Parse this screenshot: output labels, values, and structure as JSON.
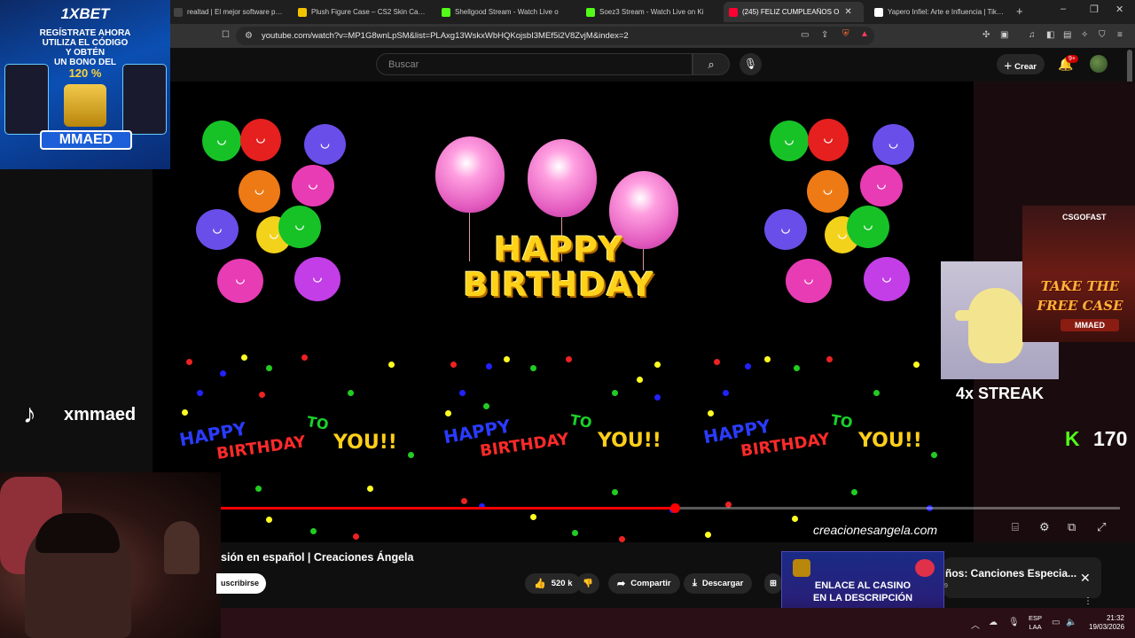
{
  "browser": {
    "tabs": [
      {
        "title": "realtad | El mejor software para pote",
        "favicon_color": "#444444"
      },
      {
        "title": "Plush Figure Case – CS2 Skin Case O",
        "favicon_color": "#f2c400"
      },
      {
        "title": "Shellgood Stream - Watch Live o",
        "favicon_color": "#53fc18"
      },
      {
        "title": "Soez3 Stream - Watch Live on Ki",
        "favicon_color": "#53fc18"
      },
      {
        "title": "(245) FELIZ CUMPLEAÑOS O",
        "favicon_color": "#ff0033",
        "active": true
      },
      {
        "title": "Yapero Infiel: Arte e Influencia | TikTo",
        "favicon_color": "#ffffff"
      }
    ],
    "new_tab": "+",
    "window_controls": [
      "–",
      "❐",
      "✕"
    ],
    "url": "youtube.com/watch?v=MP1G8wnLpSM&list=PLAxg13WskxWbHQKojsbI3MEf5i2V8ZvjM&index=2"
  },
  "youtube": {
    "search_placeholder": "Buscar",
    "create_label": "Crear",
    "notifications_badge": "9+",
    "video": {
      "banner_line1": "HAPPY",
      "banner_line2": "BIRTHDAY",
      "greeting_words": [
        "HAPPY",
        "BIRTHDAY",
        "TO",
        "YOU!!"
      ],
      "watermark": "creacionesangela.com",
      "progress_fraction": 0.505
    },
    "title_fragment": "sión en español | Creaciones Ángela",
    "subscribe_label": "uscribirse",
    "likes": "520 k",
    "share_label": "Compartir",
    "download_label": "Descargar",
    "next_title": "ños: Canciones Especia...",
    "next_sub": "9"
  },
  "stream_overlay": {
    "ad_brand": "1XBET",
    "ad_lines": [
      "REGÍSTRATE AHORA",
      "UTILIZA EL CÓDIGO",
      "Y OBTÉN",
      "UN BONO DEL"
    ],
    "ad_bonus": "120 %",
    "ad_code": "MMAED",
    "tiktok_user": "xmmaed",
    "streak_label": "4x STREAK",
    "kick_count": "170",
    "cs_brand": "CSGOFAST",
    "cs_slogan_line1": "TAKE THE",
    "cs_slogan_line2": "FREE CASE",
    "cs_user": "MMAED",
    "casino_line1": "ENLACE AL CASINO",
    "casino_line2": "EN LA DESCRIPCIÓN"
  },
  "taskbar": {
    "lang_line1": "ESP",
    "lang_line2": "LAA",
    "time": "21:32",
    "date": "19/03/2026"
  },
  "colors": {
    "yt_red": "#ff0000",
    "kick_green": "#53fc18",
    "banner_yellow": "#ffd21a"
  }
}
